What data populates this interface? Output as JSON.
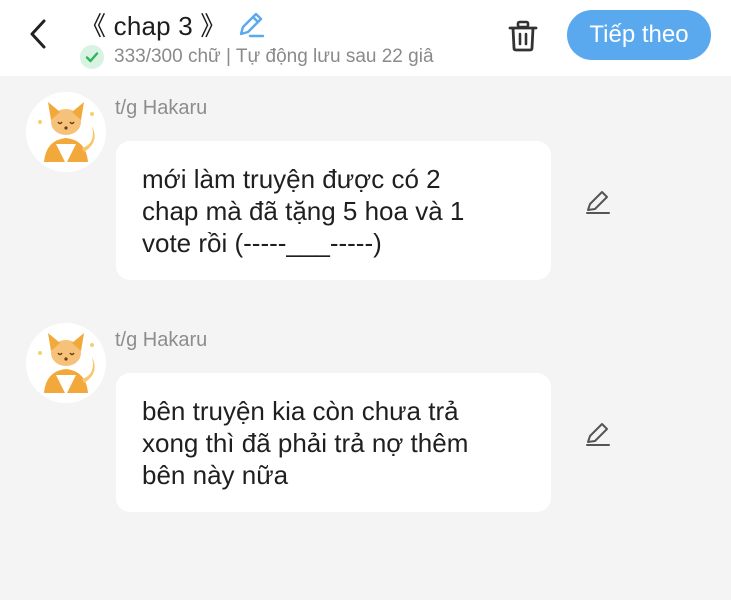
{
  "header": {
    "back_icon": "chevron-left-icon",
    "title": "《 chap 3 》",
    "title_edit_icon": "pencil-icon",
    "status_icon": "check-icon",
    "status_text": "333/300 chữ | Tự động lưu sau 22 giâ",
    "delete_icon": "trash-icon",
    "next_label": "Tiếp theo",
    "accent_color": "#5aa9ee"
  },
  "messages": [
    {
      "author": "t/g Hakaru",
      "avatar_icon": "fox-avatar-icon",
      "text": "mới làm truyện được có 2 chap mà đã tặng 5 hoa và 1 vote rồi (-----___-----)",
      "lines": [
        "mới làm truyện được có 2",
        "chap mà đã tặng 5 hoa và 1",
        "vote rồi (-----___-----)"
      ],
      "edit_icon": "pencil-icon"
    },
    {
      "author": "t/g Hakaru",
      "avatar_icon": "fox-avatar-icon",
      "text": "bên truyện kia còn chưa trả xong thì đã phải trả nợ thêm bên này nữa",
      "lines": [
        "bên truyện kia còn chưa trả",
        "xong thì đã phải trả nợ thêm",
        "bên này nữa"
      ],
      "edit_icon": "pencil-icon"
    }
  ]
}
